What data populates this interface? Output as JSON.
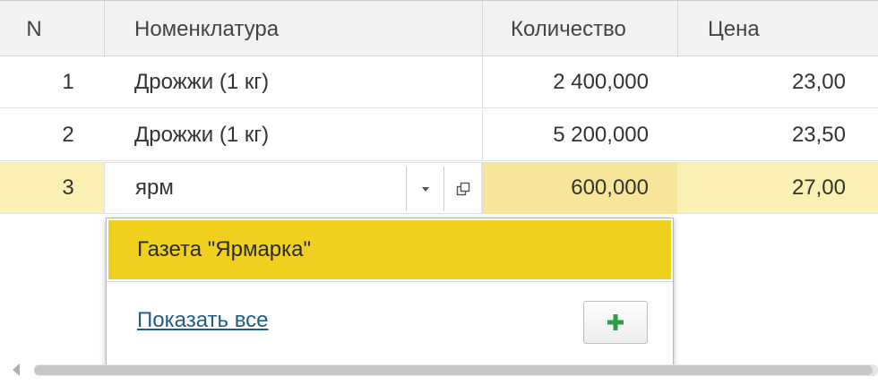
{
  "columns": {
    "n": "N",
    "name": "Номенклатура",
    "qty": "Количество",
    "price": "Цена"
  },
  "rows": [
    {
      "n": "1",
      "name": "Дрожжи (1 кг)",
      "qty": "2 400,000",
      "price": "23,00"
    },
    {
      "n": "2",
      "name": "Дрожжи (1 кг)",
      "qty": "5 200,000",
      "price": "23,50"
    },
    {
      "n": "3",
      "name": "ярм",
      "qty": "600,000",
      "price": "27,00"
    }
  ],
  "editor": {
    "value": "ярм",
    "dropdown_icon": "triangle-down-icon",
    "open_icon": "open-form-icon"
  },
  "dropdown": {
    "items": [
      "Газета \"Ярмарка\""
    ],
    "show_all": "Показать все",
    "add_icon": "plus-icon"
  },
  "colors": {
    "selected_row": "#fbf0b4",
    "selected_qty": "#f7e699",
    "highlight_item": "#f0d01f",
    "link": "#1f5c8a",
    "plus": "#2e9c46"
  }
}
